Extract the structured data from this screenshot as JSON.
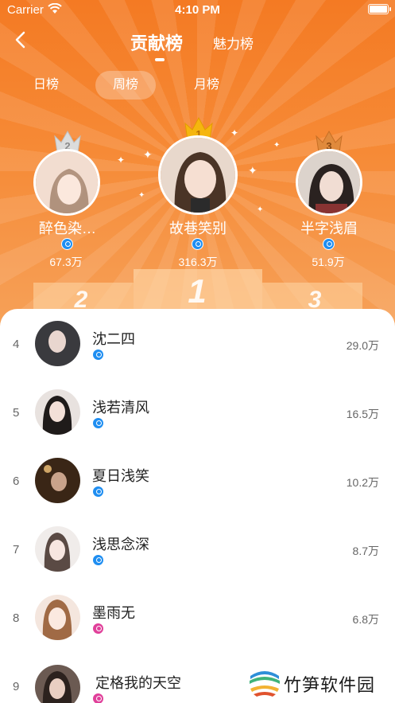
{
  "status_bar": {
    "carrier": "Carrier",
    "time": "4:10 PM"
  },
  "nav": {
    "tab_active": "贡献榜",
    "tab_other": "魅力榜"
  },
  "periods": [
    {
      "label": "日榜",
      "active": false
    },
    {
      "label": "周榜",
      "active": true
    },
    {
      "label": "月榜",
      "active": false
    }
  ],
  "podium": {
    "first": "1",
    "second": "2",
    "third": "3"
  },
  "top3": [
    {
      "rank": "2",
      "name": "醉色染…",
      "score": "67.3万",
      "badge": "blue"
    },
    {
      "rank": "1",
      "name": "故巷笑别",
      "score": "316.3万",
      "badge": "blue"
    },
    {
      "rank": "3",
      "name": "半字浅眉",
      "score": "51.9万",
      "badge": "blue"
    }
  ],
  "list": [
    {
      "rank": "4",
      "name": "沈二四",
      "score": "29.0万",
      "badge": "blue"
    },
    {
      "rank": "5",
      "name": "浅若清风",
      "score": "16.5万",
      "badge": "blue"
    },
    {
      "rank": "6",
      "name": "夏日浅笑",
      "score": "10.2万",
      "badge": "blue"
    },
    {
      "rank": "7",
      "name": "浅思念深",
      "score": "8.7万",
      "badge": "blue"
    },
    {
      "rank": "8",
      "name": "墨雨无",
      "score": "6.8万",
      "badge": "pink"
    },
    {
      "rank": "9",
      "name": "定格我的天空",
      "score": "",
      "badge": "pink"
    }
  ],
  "watermark": {
    "text": "竹笋软件园"
  },
  "colors": {
    "header_orange": "#f47a23",
    "badge_blue": "#1f8ef1",
    "badge_pink": "#e0409a",
    "gold": "#f5b60e",
    "silver": "#d9d9d9",
    "bronze": "#e08a3c"
  }
}
